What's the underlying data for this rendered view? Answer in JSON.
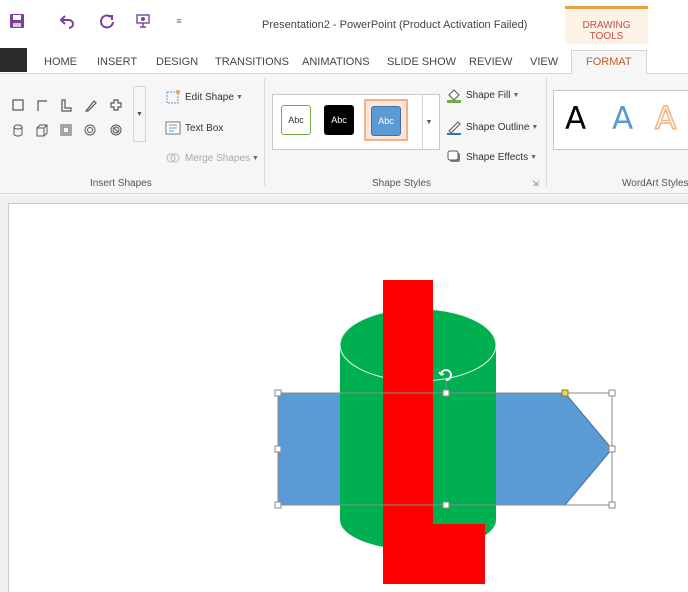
{
  "titlebar": {
    "title": "Presentation2 - PowerPoint (Product Activation Failed)",
    "context_tab_group": "DRAWING TOOLS",
    "qat": [
      {
        "name": "save-icon"
      },
      {
        "name": "undo-icon"
      },
      {
        "name": "redo-icon"
      },
      {
        "name": "start-slideshow-icon"
      },
      {
        "name": "customize-qat-icon"
      }
    ]
  },
  "tabs": [
    {
      "label": "HOME"
    },
    {
      "label": "INSERT"
    },
    {
      "label": "DESIGN"
    },
    {
      "label": "TRANSITIONS"
    },
    {
      "label": "ANIMATIONS"
    },
    {
      "label": "SLIDE SHOW"
    },
    {
      "label": "REVIEW"
    },
    {
      "label": "VIEW"
    },
    {
      "label": "FORMAT",
      "active": true
    }
  ],
  "ribbon": {
    "insert_shapes": {
      "label": "Insert Shapes",
      "edit_shape": "Edit Shape",
      "text_box": "Text Box",
      "merge_shapes": "Merge Shapes",
      "shapes": [
        "rectangle-icon",
        "corner-icon",
        "l-shape-icon",
        "freeform-icon",
        "cross-icon",
        "can-icon",
        "cube-icon",
        "frame-icon",
        "donut-icon",
        "no-symbol-icon"
      ]
    },
    "shape_styles": {
      "label": "Shape Styles",
      "swatch_text": "Abc",
      "swatches": [
        {
          "name": "style-swatch-white-outline",
          "fill": "#ffffff",
          "border": "#70ad47",
          "text": "#333333"
        },
        {
          "name": "style-swatch-black",
          "fill": "#000000",
          "border": "#000000",
          "text": "#ffffff"
        },
        {
          "name": "style-swatch-blue",
          "fill": "#5b9bd5",
          "border": "#41719c",
          "text": "#ffffff",
          "selected": true
        }
      ],
      "shape_fill": "Shape Fill",
      "shape_outline": "Shape Outline",
      "shape_effects": "Shape Effects"
    },
    "wordart_styles": {
      "label": "WordArt Styles",
      "samples": [
        {
          "text": "A",
          "color": "#000000"
        },
        {
          "text": "A",
          "color": "#5b9bd5"
        },
        {
          "text": "A",
          "color": "#f4b183"
        }
      ]
    }
  },
  "colors": {
    "accent": "#c75b2b",
    "blue_arrow": "#5b9bd5",
    "green_can": "#00b050",
    "red_shape": "#ff0000"
  }
}
